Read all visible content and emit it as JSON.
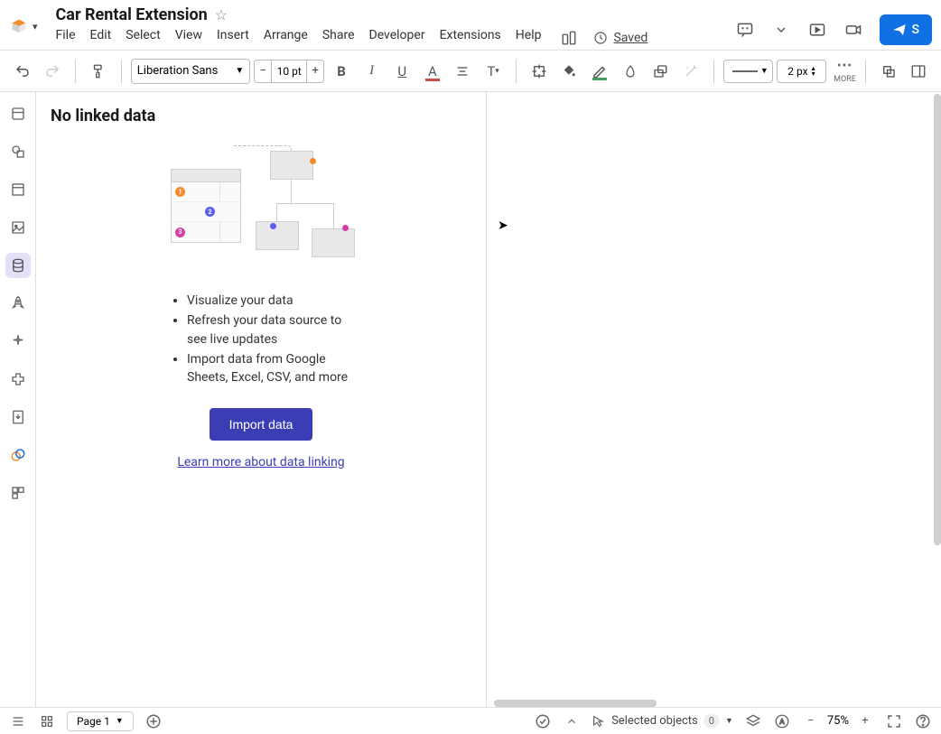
{
  "header": {
    "title": "Car Rental Extension",
    "menus": [
      "File",
      "Edit",
      "Select",
      "View",
      "Insert",
      "Arrange",
      "Share",
      "Developer",
      "Extensions",
      "Help"
    ],
    "saved_label": "Saved",
    "share_button": "S"
  },
  "toolbar": {
    "font_family": "Liberation Sans",
    "font_size": "10 pt",
    "line_width": "2 px",
    "more_label": "MORE"
  },
  "panel": {
    "title": "No linked data",
    "bullets": [
      "Visualize your data",
      "Refresh your data source to see live updates",
      "Import data from Google Sheets, Excel, CSV, and more"
    ],
    "import_button": "Import data",
    "learn_link": "Learn more about data linking",
    "illustration_nums": [
      "1",
      "2",
      "3"
    ]
  },
  "footer": {
    "page_label": "Page 1",
    "selected_label": "Selected objects",
    "selected_count": "0",
    "zoom": "75%"
  }
}
